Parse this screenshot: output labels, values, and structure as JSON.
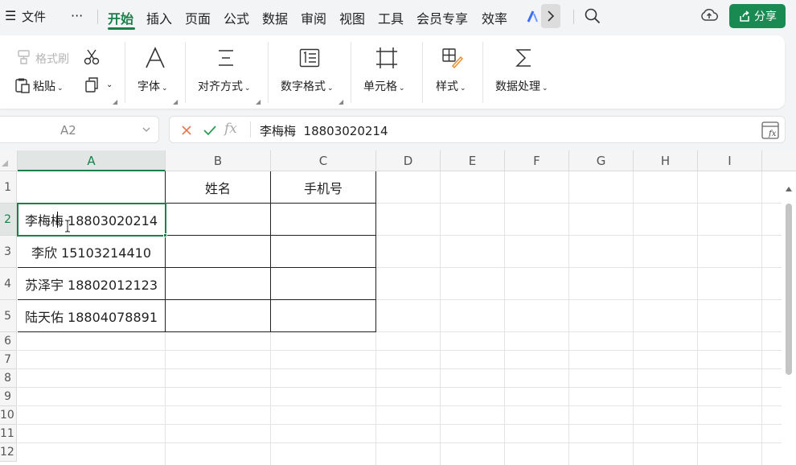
{
  "menu": {
    "hamburger": "☰",
    "file": "文件",
    "more": "···",
    "tabs": [
      "开始",
      "插入",
      "页面",
      "公式",
      "数据",
      "审阅",
      "视图",
      "工具",
      "会员专享",
      "效率"
    ],
    "share": "分享"
  },
  "ribbon": {
    "format_painter": "格式刷",
    "paste": "粘贴",
    "font": "字体",
    "align": "对齐方式",
    "number_format": "数字格式",
    "cell": "单元格",
    "style": "样式",
    "data_process": "数据处理"
  },
  "formula": {
    "name_box": "A2",
    "content": "李梅梅  18803020214",
    "fx": "fx"
  },
  "sheet": {
    "columns": [
      "A",
      "B",
      "C",
      "D",
      "E",
      "F",
      "G",
      "H",
      "I"
    ],
    "rows": [
      "1",
      "2",
      "3",
      "4",
      "5",
      "6",
      "7",
      "8",
      "9",
      "10",
      "11",
      "12"
    ],
    "header_b": "姓名",
    "header_c": "手机号",
    "a2": "李梅梅 18803020214",
    "a3": "李欣 15103214410",
    "a4": "苏泽宇 18802012123",
    "a5": "陆天佑 18804078891"
  },
  "colors": {
    "accent": "#1a7f4b",
    "share_bg": "#1a8a53"
  }
}
